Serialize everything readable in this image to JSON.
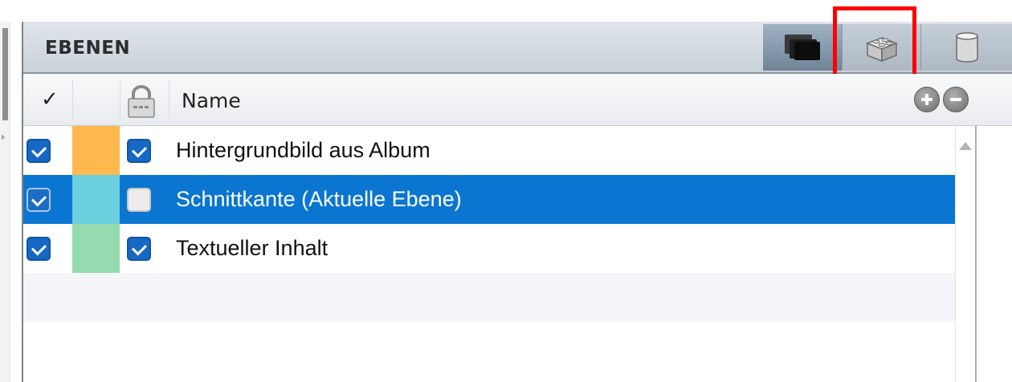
{
  "panel": {
    "title": "EBENEN",
    "view_buttons": [
      {
        "name": "layers-view",
        "icon": "stacked-layers-icon"
      },
      {
        "name": "objects-view",
        "icon": "building-block-icon",
        "highlighted": true
      },
      {
        "name": "database-view",
        "icon": "database-cylinder-icon"
      }
    ],
    "highlight_color": "#ff0000"
  },
  "columns": {
    "visible_header": "✓",
    "lock_header_icon": "padlock-icon",
    "name_header": "Name",
    "add_icon": "plus-circle-icon",
    "remove_icon": "minus-circle-icon"
  },
  "layers": [
    {
      "visible": true,
      "color": "#ffb84d",
      "locked": true,
      "label": "Hintergrundbild aus Album",
      "selected": false
    },
    {
      "visible": true,
      "color": "#6cd0de",
      "locked": false,
      "label": "Schnittkante (Aktuelle Ebene)",
      "selected": true
    },
    {
      "visible": true,
      "color": "#94dbb0",
      "locked": true,
      "label": "Textueller Inhalt",
      "selected": false
    }
  ],
  "colors": {
    "selection": "#0a76d1",
    "checkbox": "#1668c2"
  }
}
